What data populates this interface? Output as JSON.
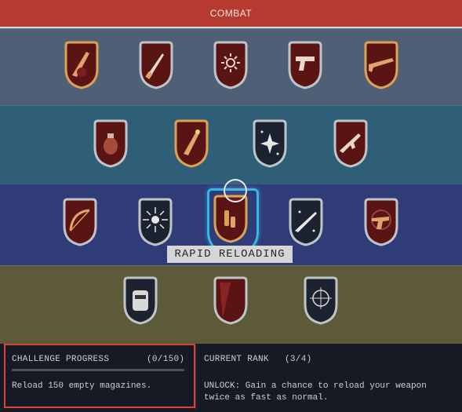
{
  "header": {
    "title": "COMBAT"
  },
  "tooltip": {
    "label": "RAPID RELOADING"
  },
  "skills": {
    "tier1": [
      "rifle-grip-icon",
      "knife-icon",
      "sun-burst-icon",
      "pistol-icon",
      "shotgun-icon"
    ],
    "tier2": [
      "grenade-icon",
      "missile-icon",
      "sparkle-icon",
      "assault-rifle-icon"
    ],
    "tier3": [
      "bow-icon",
      "radiant-sun-icon",
      "bullets-icon",
      "sniper-rifle-icon",
      "revolver-scope-icon"
    ],
    "tier4": [
      "raccoon-icon",
      "armor-panel-icon",
      "crosshair-icon"
    ],
    "selected": "bullets-icon"
  },
  "challenge": {
    "title": "CHALLENGE PROGRESS",
    "count": "(0/150)",
    "progress_fraction": 0,
    "description": "Reload 150 empty magazines."
  },
  "rank": {
    "title": "CURRENT RANK",
    "count": "(3/4)",
    "description": "UNLOCK: Gain a chance to reload your weapon twice as fast as normal."
  },
  "colors": {
    "header": "#b73b30",
    "highlight": "#e0403a",
    "selected_ring": "#36b8e6",
    "badge_fill": "#5a1414",
    "badge_gold": "#d8a453",
    "badge_silver": "#bfc4c9"
  }
}
